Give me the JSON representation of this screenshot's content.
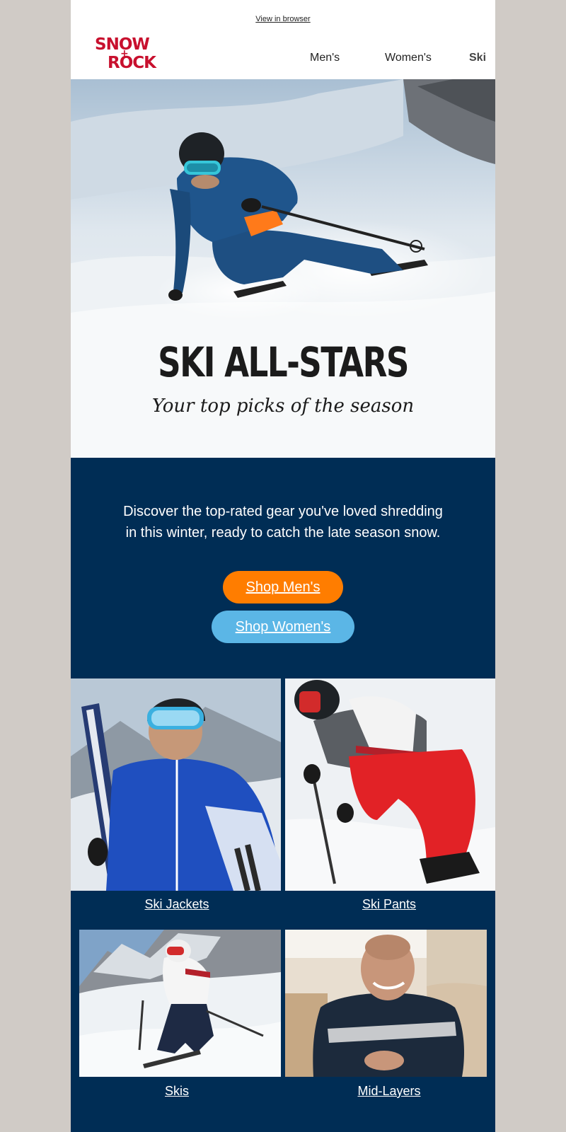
{
  "header": {
    "view_in_browser": "View in browser",
    "logo_alt": "SNOW ROCK",
    "nav": {
      "mens": "Men's",
      "womens": "Women's",
      "ski": "Ski"
    }
  },
  "hero": {
    "title": "SKI ALL-STARS",
    "subtitle": "Your top picks of the season"
  },
  "intro": {
    "text": "Discover the top-rated gear you've loved shredding in this winter, ready to catch the late season snow.",
    "shop_mens": "Shop Men's",
    "shop_womens": "Shop Women's"
  },
  "categories": [
    {
      "label": "Ski Jackets"
    },
    {
      "label": "Ski Pants"
    },
    {
      "label": "Skis"
    },
    {
      "label": "Mid-Layers"
    }
  ],
  "colors": {
    "navy": "#002d55",
    "orange": "#ff7d00",
    "light_blue": "#5bb6e6",
    "brand_red": "#c8102e",
    "page_bg": "#d0cbc6"
  }
}
